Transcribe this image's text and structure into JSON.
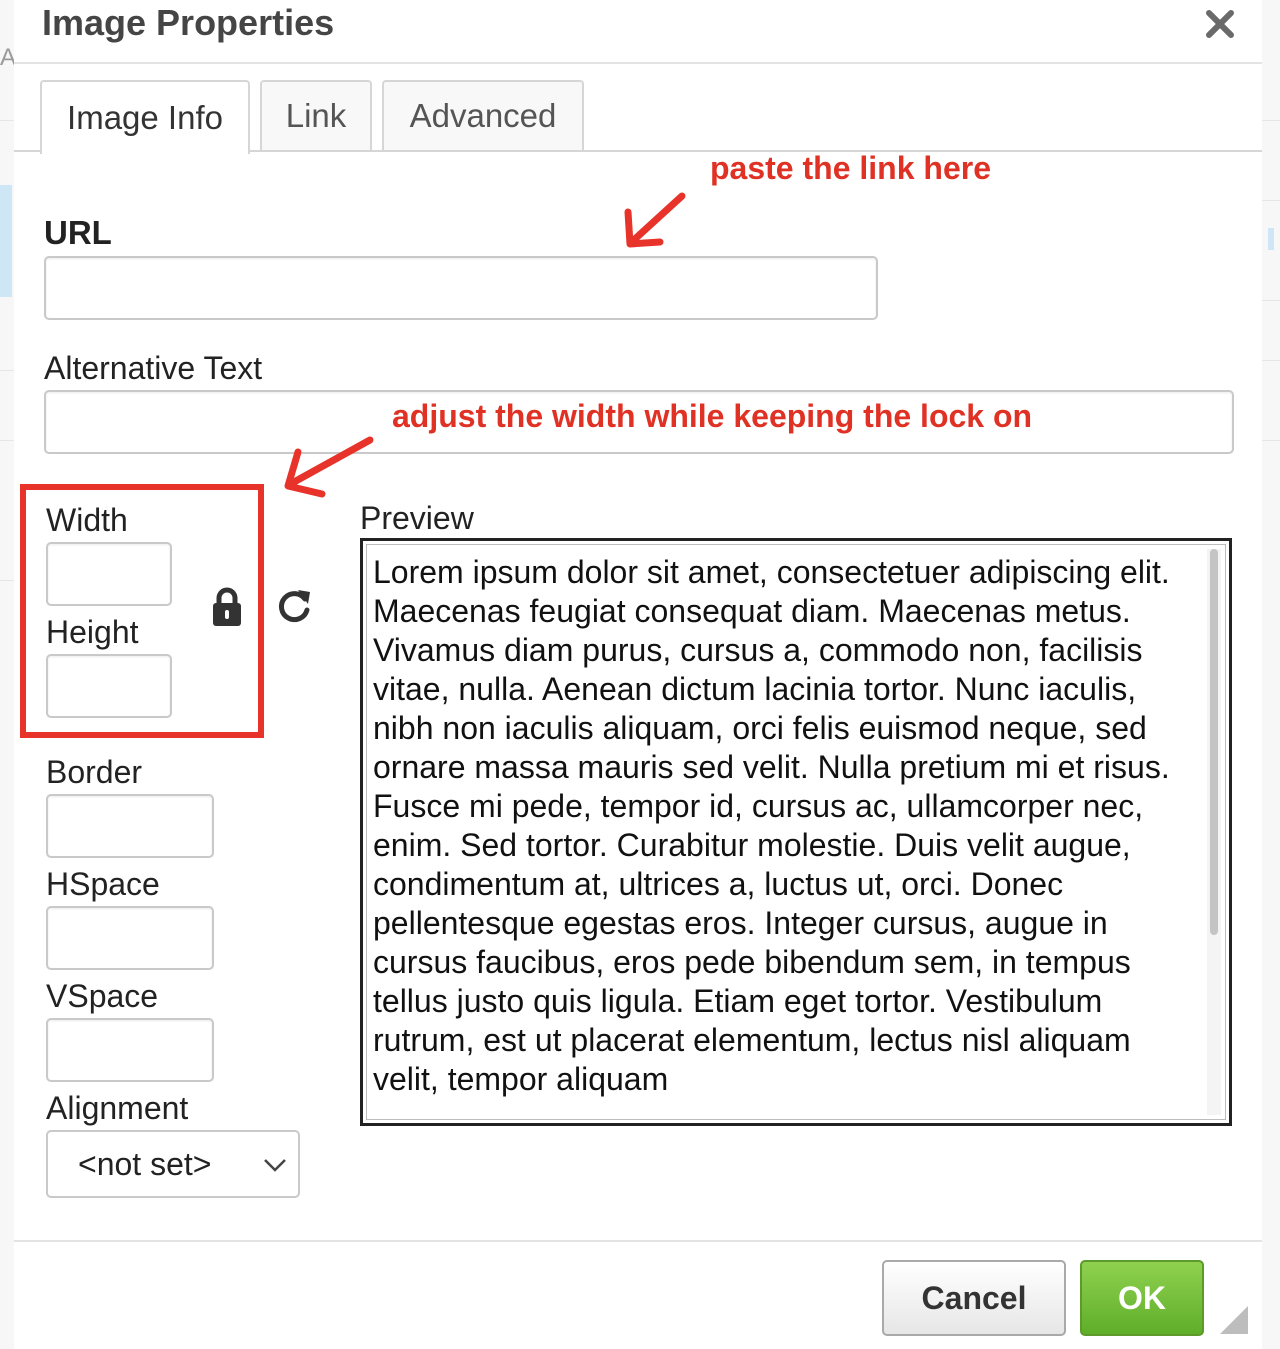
{
  "dialog": {
    "title": "Image Properties"
  },
  "tabs": [
    {
      "label": "Image Info",
      "active": true
    },
    {
      "label": "Link",
      "active": false
    },
    {
      "label": "Advanced",
      "active": false
    }
  ],
  "fields": {
    "url": {
      "label": "URL",
      "value": ""
    },
    "alt_text": {
      "label": "Alternative Text",
      "value": ""
    },
    "width": {
      "label": "Width",
      "value": ""
    },
    "height": {
      "label": "Height",
      "value": ""
    },
    "border": {
      "label": "Border",
      "value": ""
    },
    "hspace": {
      "label": "HSpace",
      "value": ""
    },
    "vspace": {
      "label": "VSpace",
      "value": ""
    },
    "alignment": {
      "label": "Alignment",
      "selected": "<not set>"
    }
  },
  "preview": {
    "label": "Preview",
    "text": "Lorem ipsum dolor sit amet, consectetuer adipiscing elit. Maecenas feugiat consequat diam. Maecenas metus. Vivamus diam purus, cursus a, commodo non, facilisis vitae, nulla. Aenean dictum lacinia tortor. Nunc iaculis, nibh non iaculis aliquam, orci felis euismod neque, sed ornare massa mauris sed velit. Nulla pretium mi et risus. Fusce mi pede, tempor id, cursus ac, ullamcorper nec, enim. Sed tortor. Curabitur molestie. Duis velit augue, condimentum at, ultrices a, luctus ut, orci. Donec pellentesque egestas eros. Integer cursus, augue in cursus faucibus, eros pede bibendum sem, in tempus tellus justo quis ligula. Etiam eget tortor. Vestibulum rutrum, est ut placerat elementum, lectus nisl aliquam velit, tempor aliquam"
  },
  "annotations": {
    "paste_link": "paste the link here",
    "adjust_width": "adjust the width while keeping the lock on"
  },
  "buttons": {
    "cancel": "Cancel",
    "ok": "OK"
  },
  "icons": {
    "close": "close-icon",
    "lock": "lock-icon",
    "reset": "reset-size-icon",
    "dropdown": "chevron-down-icon",
    "resize": "resize-grip-icon"
  },
  "colors": {
    "annotation_red": "#e03125",
    "ok_green": "#6cbf35",
    "title_gray": "#454545"
  }
}
